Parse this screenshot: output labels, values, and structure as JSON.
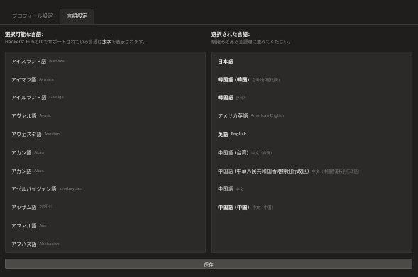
{
  "tabs": [
    {
      "label": "プロフィール設定"
    },
    {
      "label": "言語設定"
    }
  ],
  "available": {
    "title": "選択可能な言語：",
    "desc_before": "Hackers' PubのUIでサポートされている言語は",
    "desc_bold": "太字",
    "desc_after": "で表示されます。",
    "items": [
      {
        "name": "アイスランド語",
        "native": "íslenska"
      },
      {
        "name": "アイマラ語",
        "native": "Aymara"
      },
      {
        "name": "アイルランド語",
        "native": "Gaeilge"
      },
      {
        "name": "アヴァル語",
        "native": "Avaric"
      },
      {
        "name": "アヴェスタ語",
        "native": "Avestan"
      },
      {
        "name": "アカン語",
        "native": "Akan"
      },
      {
        "name": "アカン語",
        "native": "Akan"
      },
      {
        "name": "アゼルバイジャン語",
        "native": "azərbaycan"
      },
      {
        "name": "アッサム語",
        "native": "অসমীয়া"
      },
      {
        "name": "アファル語",
        "native": "Afar"
      },
      {
        "name": "アブハズ語",
        "native": "Abkhazian"
      }
    ]
  },
  "selected": {
    "title": "選択された言語：",
    "desc": "馴染みのある言語順に並べてください。",
    "items": [
      {
        "name": "日本語",
        "native": ""
      },
      {
        "name": "韓国語 (韓国)",
        "native": "한국어(대한민국)"
      },
      {
        "name": "韓国語",
        "native": "한국어"
      },
      {
        "name": "アメリカ英語",
        "native": "American English"
      },
      {
        "name": "英語",
        "native": "English"
      },
      {
        "name": "中国語 (台湾)",
        "native": "中文（台灣）"
      },
      {
        "name": "中国語 (中華人民共和国香港特別行政区)",
        "native": "中文（中國香港特別行政區）"
      },
      {
        "name": "中国語",
        "native": "中文"
      },
      {
        "name": "中国語 (中国)",
        "native": "中文（中国）"
      }
    ]
  },
  "save_label": "保存"
}
